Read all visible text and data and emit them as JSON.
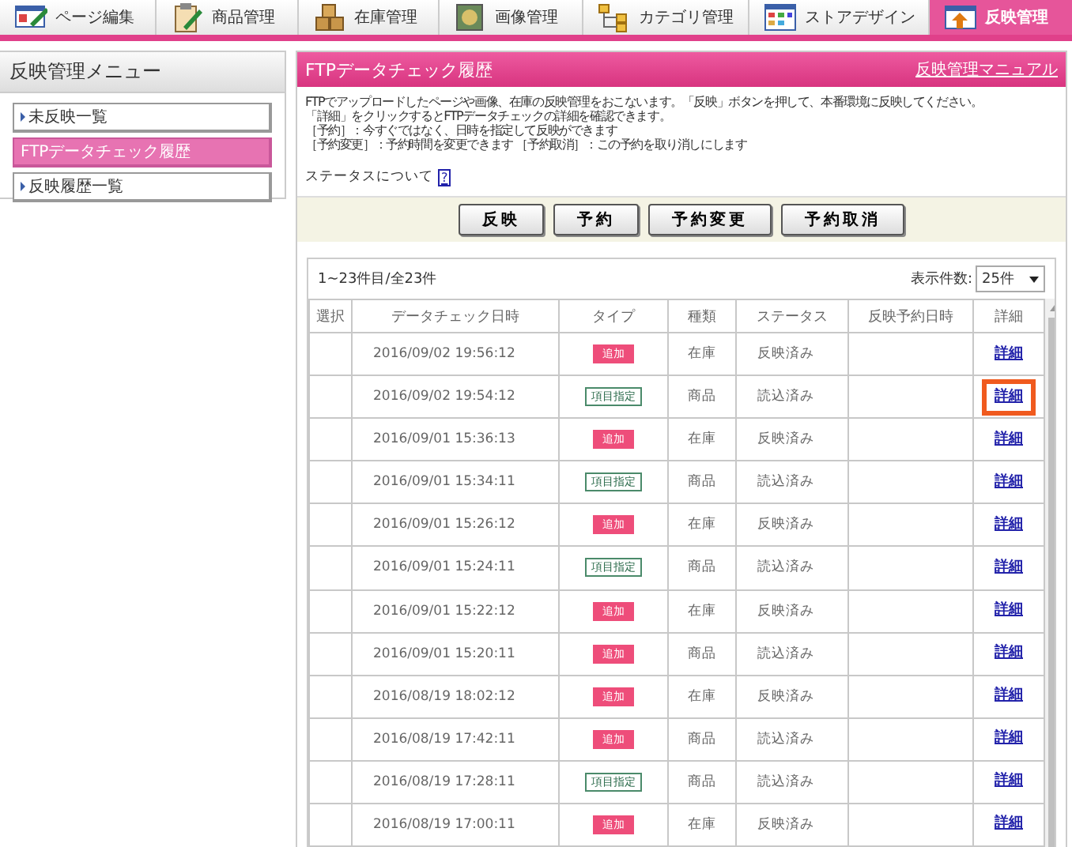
{
  "nav_tabs": [
    {
      "label": "ページ編集",
      "selected": false
    },
    {
      "label": "商品管理",
      "selected": false
    },
    {
      "label": "在庫管理",
      "selected": false
    },
    {
      "label": "画像管理",
      "selected": false
    },
    {
      "label": "カテゴリ管理",
      "selected": false
    },
    {
      "label": "ストアデザイン",
      "selected": false
    },
    {
      "label": "反映管理",
      "selected": true
    }
  ],
  "sidebar": {
    "title": "反映管理メニュー",
    "items": [
      {
        "label": "未反映一覧",
        "selected": false
      },
      {
        "label": "FTPデータチェック履歴",
        "selected": true
      },
      {
        "label": "反映履歴一覧",
        "selected": false
      }
    ]
  },
  "panel": {
    "title": "FTPデータチェック履歴",
    "manual_link": "反映管理マニュアル",
    "description": [
      "FTPでアップロードしたページや画像、在庫の反映管理をおこないます。「反映」ボタンを押して、本番環境に反映してください。",
      "「詳細」をクリックするとFTPデータチェックの詳細を確認できます。",
      "［予約］：今すぐではなく、日時を指定して反映ができます",
      "［予約変更］：予約時間を変更できます ［予約取消］：この予約を取り消しにします"
    ],
    "status_label": "ステータスについて",
    "status_help": "?"
  },
  "buttons": [
    "反映",
    "予約",
    "予約変更",
    "予約取消"
  ],
  "table": {
    "range": "1~23件目/全23件",
    "per_page_label": "表示件数:",
    "per_page": "25件",
    "columns": [
      "選択",
      "データチェック日時",
      "タイプ",
      "種類",
      "ステータス",
      "反映予約日時",
      "詳細"
    ],
    "rows": [
      {
        "datetime": "2016/09/02 19:56:12",
        "type": "追加",
        "kind": "add",
        "category": "在庫",
        "status": "反映済み",
        "detail": "詳細",
        "highlighted": false
      },
      {
        "datetime": "2016/09/02 19:54:12",
        "type": "項目指定",
        "kind": "field",
        "category": "商品",
        "status": "読込済み",
        "detail": "詳細",
        "highlighted": true
      },
      {
        "datetime": "2016/09/01 15:36:13",
        "type": "追加",
        "kind": "add",
        "category": "在庫",
        "status": "反映済み",
        "detail": "詳細",
        "highlighted": false
      },
      {
        "datetime": "2016/09/01 15:34:11",
        "type": "項目指定",
        "kind": "field",
        "category": "商品",
        "status": "読込済み",
        "detail": "詳細",
        "highlighted": false
      },
      {
        "datetime": "2016/09/01 15:26:12",
        "type": "追加",
        "kind": "add",
        "category": "在庫",
        "status": "反映済み",
        "detail": "詳細",
        "highlighted": false
      },
      {
        "datetime": "2016/09/01 15:24:11",
        "type": "項目指定",
        "kind": "field",
        "category": "商品",
        "status": "読込済み",
        "detail": "詳細",
        "highlighted": false
      },
      {
        "datetime": "2016/09/01 15:22:12",
        "type": "追加",
        "kind": "add",
        "category": "在庫",
        "status": "反映済み",
        "detail": "詳細",
        "highlighted": false
      },
      {
        "datetime": "2016/09/01 15:20:11",
        "type": "追加",
        "kind": "add",
        "category": "商品",
        "status": "読込済み",
        "detail": "詳細",
        "highlighted": false
      },
      {
        "datetime": "2016/08/19 18:02:12",
        "type": "追加",
        "kind": "add",
        "category": "在庫",
        "status": "反映済み",
        "detail": "詳細",
        "highlighted": false
      },
      {
        "datetime": "2016/08/19 17:42:11",
        "type": "追加",
        "kind": "add",
        "category": "商品",
        "status": "読込済み",
        "detail": "詳細",
        "highlighted": false
      },
      {
        "datetime": "2016/08/19 17:28:11",
        "type": "項目指定",
        "kind": "field",
        "category": "商品",
        "status": "読込済み",
        "detail": "詳細",
        "highlighted": false
      },
      {
        "datetime": "2016/08/19 17:00:11",
        "type": "追加",
        "kind": "add",
        "category": "在庫",
        "status": "反映済み",
        "detail": "詳細",
        "highlighted": false
      }
    ]
  }
}
